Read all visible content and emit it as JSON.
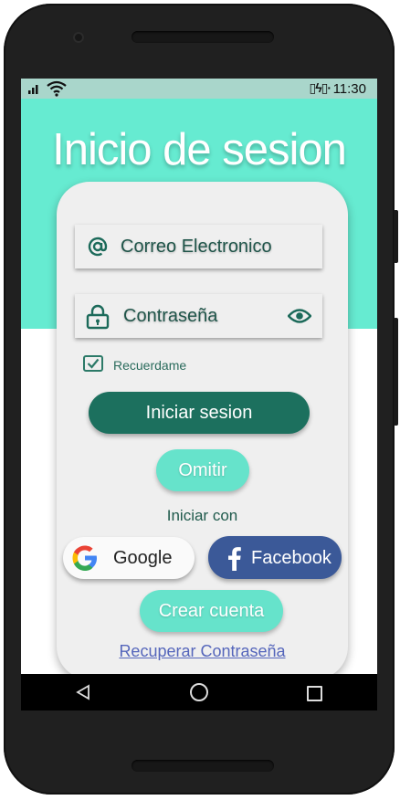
{
  "status_bar": {
    "time": "11:30",
    "battery_icon": "battery-charging-icon",
    "signal_icon": "signal-icon",
    "wifi_icon": "wifi-icon"
  },
  "login": {
    "title": "Inicio de sesion",
    "email_placeholder": "Correo Electronico",
    "password_placeholder": "Contraseña",
    "remember_label": "Recuerdame",
    "remember_checked": true,
    "sign_in_label": "Iniciar sesion",
    "skip_label": "Omitir",
    "sign_in_with_label": "Iniciar con",
    "google_label": "Google",
    "facebook_label": "Facebook",
    "create_account_label": "Crear cuenta",
    "recover_password_label": "Recuperar Contraseña"
  },
  "colors": {
    "teal": "#66ebd1",
    "dark_green": "#1c705e",
    "facebook_blue": "#3b5998",
    "card": "#efefef"
  }
}
